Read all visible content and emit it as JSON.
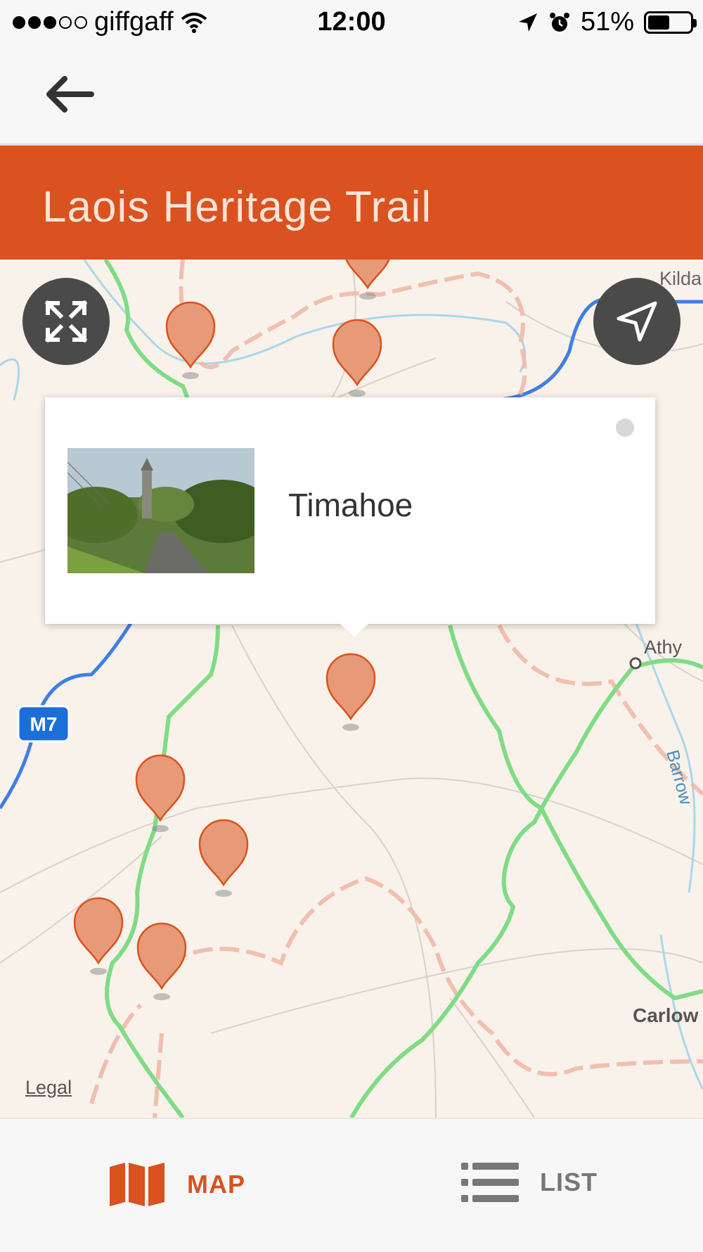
{
  "status_bar": {
    "carrier": "giffgaff",
    "time": "12:00",
    "battery": "51%",
    "battery_level": 0.51
  },
  "nav": {
    "back_icon": "arrow-left-icon"
  },
  "header": {
    "title": "Laois Heritage Trail"
  },
  "map": {
    "place_labels": [
      "Kilda",
      "Athy",
      "Barrow",
      "Carlow",
      "M7"
    ],
    "legal": "Legal",
    "popup": {
      "title": "Timahoe"
    },
    "buttons": {
      "fullscreen_icon": "expand-icon",
      "locate_icon": "navigation-arrow-icon"
    }
  },
  "tabs": [
    {
      "label": "MAP",
      "icon": "map-icon",
      "active": true
    },
    {
      "label": "LIST",
      "icon": "list-icon",
      "active": false
    }
  ],
  "colors": {
    "accent": "#d9521f",
    "map_bg": "#f9f2ea",
    "route": "#7fdc85",
    "boundary": "#f1b9a7"
  }
}
